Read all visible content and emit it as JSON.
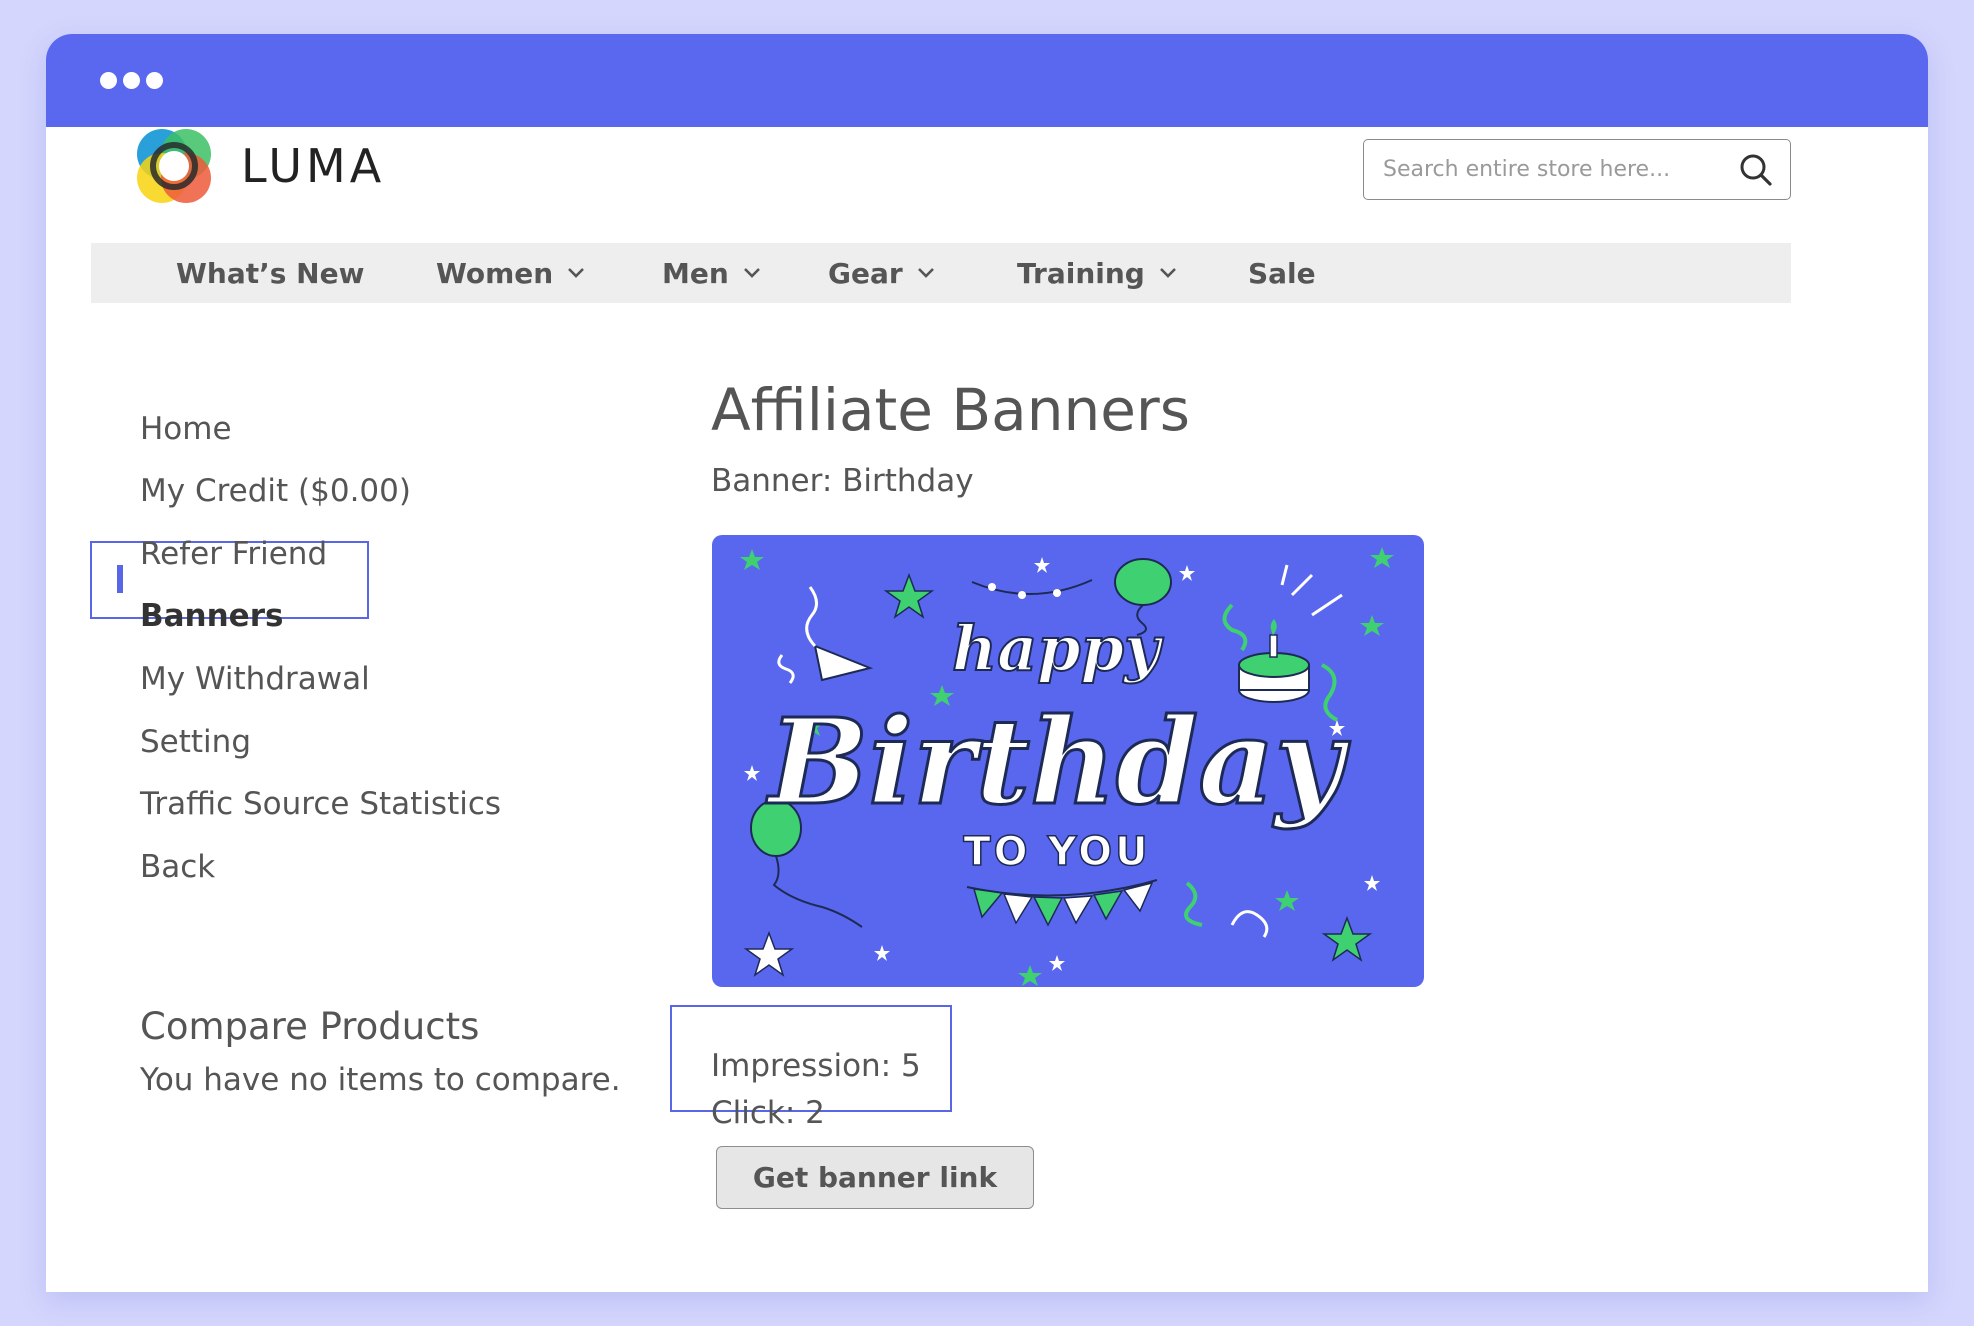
{
  "browser": {
    "dots": [
      "dot",
      "dot",
      "dot"
    ]
  },
  "header": {
    "brand": "LUMA",
    "logo_icon": "luma-logo-icon",
    "search": {
      "placeholder": "Search entire store here...",
      "icon": "search-icon"
    }
  },
  "nav": {
    "items": [
      {
        "label": "What’s New",
        "has_dropdown": false
      },
      {
        "label": "Women",
        "has_dropdown": true
      },
      {
        "label": "Men",
        "has_dropdown": true
      },
      {
        "label": "Gear",
        "has_dropdown": true
      },
      {
        "label": "Training",
        "has_dropdown": true
      },
      {
        "label": "Sale",
        "has_dropdown": false
      }
    ]
  },
  "sidebar": {
    "items": [
      {
        "label": "Home"
      },
      {
        "label": "My Credit ($0.00)"
      },
      {
        "label": "Refer Friend"
      },
      {
        "label": "Banners",
        "active": true
      },
      {
        "label": "My Withdrawal"
      },
      {
        "label": "Setting"
      },
      {
        "label": "Traffic Source Statistics"
      },
      {
        "label": "Back"
      }
    ],
    "compare": {
      "title": "Compare Products",
      "empty_text": "You have no items to compare."
    }
  },
  "main": {
    "title": "Affiliate Banners",
    "banner_label": "Banner: Birthday",
    "banner_image": {
      "line1": "happy",
      "line2": "Birthday",
      "line3": "TO YOU"
    },
    "impression": "Impression: 5",
    "click": "Click: 2",
    "get_link_button": "Get banner link"
  },
  "colors": {
    "titlebar": "#5a67ef",
    "accent": "#5966e6",
    "banner_bg": "#5967ee",
    "banner_green": "#3fd071",
    "page_bg": "#d4d6fd"
  }
}
